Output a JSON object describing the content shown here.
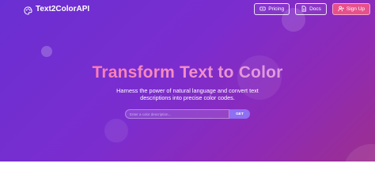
{
  "brand": {
    "name": "Text2ColorAPI",
    "icon": "palette-icon"
  },
  "nav": {
    "pricing": {
      "label": "Pricing",
      "icon": "tag-icon"
    },
    "docs": {
      "label": "Docs",
      "icon": "document-icon"
    },
    "signup": {
      "label": "Sign Up",
      "icon": "user-plus-icon"
    }
  },
  "hero": {
    "title": "Transform Text to Color",
    "subtitle": "Harness the power of natural language and convert text descriptions into precise color codes."
  },
  "search": {
    "placeholder": "Enter a color description...",
    "button_label": "GET"
  },
  "colors": {
    "background_start": "#6a2fd2",
    "background_end": "#9c2f8e",
    "signup_button": "#e7508c",
    "get_button": "#8f6ff2",
    "title_gradient_start": "#ff6aa3",
    "title_gradient_end": "#c9a9ff"
  }
}
